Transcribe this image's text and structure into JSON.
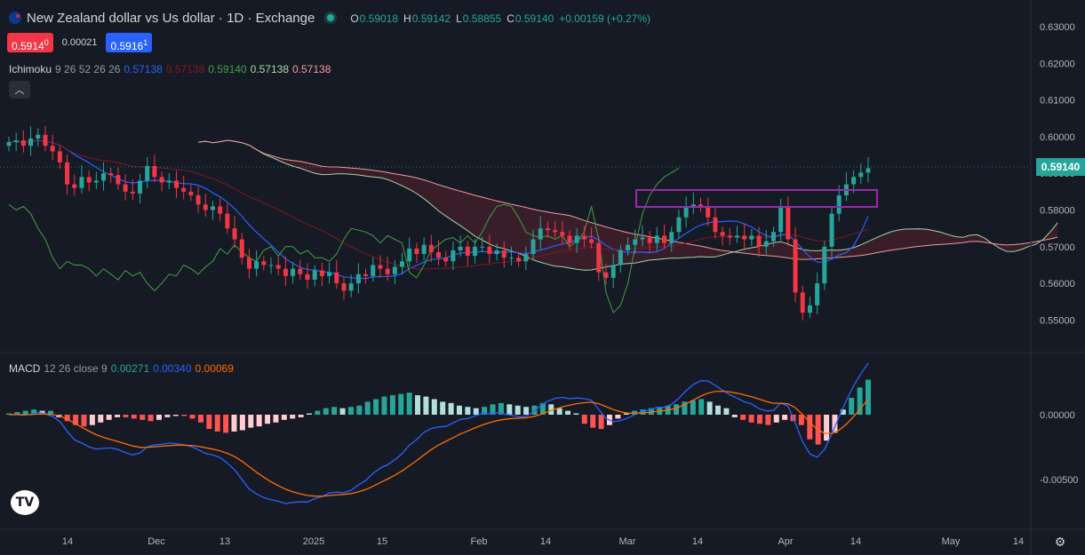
{
  "header": {
    "title": "New Zealand dollar vs Us dollar · 1D · Exchange",
    "ohlc": [
      {
        "k": "O",
        "v": "0.59018"
      },
      {
        "k": "H",
        "v": "0.59142"
      },
      {
        "k": "L",
        "v": "0.58855"
      },
      {
        "k": "C",
        "v": "0.59140"
      },
      {
        "k": "",
        "v": "+0.00159 (+0.27%)"
      }
    ]
  },
  "trade": {
    "sell_main": "0.5914",
    "sell_sup": "0",
    "spread": "0.00021",
    "buy_main": "0.5916",
    "buy_sup": "1"
  },
  "ichimoku": {
    "label": "Ichimoku",
    "params": "9 26 52 26 26",
    "v1": "0.57138",
    "v2": "0.57138",
    "v3": "0.59140",
    "v4": "0.57138",
    "v5": "0.57138"
  },
  "macd": {
    "label": "MACD",
    "params": "12 26 close 9",
    "hist": "0.00271",
    "macd": "0.00340",
    "signal": "0.00069"
  },
  "collapse_icon": "chevron-up-icon",
  "current_price": "0.59140",
  "logo_text": "TV",
  "colors": {
    "bg": "#161a25",
    "up": "#26a69a",
    "down": "#f23645",
    "conversion": "#2962ff",
    "base": "#801922",
    "lagging": "#43a047",
    "span_a": "#a5d6a7",
    "span_b": "#ef9a9a",
    "macd_line": "#2962ff",
    "signal_line": "#ff6d00",
    "box": "#9c27b0"
  },
  "chart_data": {
    "type": "candlestick",
    "price_axis": [
      "0.63000",
      "0.62000",
      "0.61000",
      "0.60000",
      "0.59000",
      "0.58000",
      "0.57000",
      "0.56000",
      "0.55000"
    ],
    "macd_axis": [
      "0.00000",
      "-0.00500"
    ],
    "time_axis": [
      "14",
      "Dec",
      "13",
      "2025",
      "15",
      "Feb",
      "14",
      "Mar",
      "14",
      "Apr",
      "14",
      "May",
      "14"
    ],
    "candles_close": [
      0.5985,
      0.599,
      0.5975,
      0.5995,
      0.6005,
      0.5975,
      0.596,
      0.593,
      0.587,
      0.586,
      0.589,
      0.5875,
      0.588,
      0.59,
      0.5895,
      0.587,
      0.585,
      0.5845,
      0.588,
      0.592,
      0.589,
      0.5875,
      0.588,
      0.586,
      0.585,
      0.584,
      0.5815,
      0.58,
      0.581,
      0.579,
      0.575,
      0.572,
      0.567,
      0.564,
      0.566,
      0.565,
      0.565,
      0.564,
      0.562,
      0.564,
      0.5625,
      0.561,
      0.5635,
      0.562,
      0.563,
      0.56,
      0.558,
      0.56,
      0.5625,
      0.562,
      0.565,
      0.564,
      0.5625,
      0.5645,
      0.566,
      0.5695,
      0.568,
      0.5705,
      0.5685,
      0.567,
      0.566,
      0.569,
      0.57,
      0.5675,
      0.57,
      0.57,
      0.568,
      0.569,
      0.567,
      0.567,
      0.566,
      0.568,
      0.572,
      0.575,
      0.5745,
      0.574,
      0.573,
      0.571,
      0.573,
      0.572,
      0.571,
      0.563,
      0.5615,
      0.565,
      0.569,
      0.5705,
      0.572,
      0.5725,
      0.571,
      0.573,
      0.571,
      0.574,
      0.578,
      0.581,
      0.5815,
      0.581,
      0.578,
      0.574,
      0.573,
      0.5725,
      0.573,
      0.572,
      0.573,
      0.57,
      0.5715,
      0.574,
      0.581,
      0.572,
      0.5575,
      0.552,
      0.554,
      0.56,
      0.57,
      0.579,
      0.584,
      0.587,
      0.589,
      0.5902,
      0.5914
    ],
    "macd_hist": [
      0.0001,
      0.0002,
      0.0003,
      0.0004,
      0.0003,
      0.0003,
      -0.0002,
      -0.0005,
      -0.0008,
      -0.0009,
      -0.0008,
      -0.0006,
      -0.0004,
      -0.0002,
      -0.0002,
      -0.0003,
      -0.0004,
      -0.0005,
      -0.0004,
      -0.0002,
      -0.0001,
      -0.0001,
      -0.0003,
      -0.0006,
      -0.0011,
      -0.0013,
      -0.0014,
      -0.0013,
      -0.0012,
      -0.001,
      -0.0009,
      -0.0007,
      -0.0006,
      -0.0004,
      -0.0003,
      -0.0002,
      0.0001,
      0.0003,
      0.0005,
      0.0006,
      0.0005,
      0.0006,
      0.0007,
      0.001,
      0.0012,
      0.0014,
      0.0015,
      0.0016,
      0.0017,
      0.0015,
      0.0014,
      0.0012,
      0.001,
      0.0009,
      0.0007,
      0.0006,
      0.0005,
      0.0006,
      0.0008,
      0.0009,
      0.0008,
      0.0007,
      0.0006,
      0.0007,
      0.0009,
      0.0008,
      0.0005,
      0.0003,
      0.0001,
      -0.0007,
      -0.001,
      -0.0011,
      -0.0008,
      -0.0003,
      0.0001,
      0.0003,
      0.0004,
      0.0005,
      0.0006,
      0.0007,
      0.0008,
      0.001,
      0.0011,
      0.0012,
      0.001,
      0.0007,
      0.0005,
      -0.0002,
      -0.0004,
      -0.0006,
      -0.0007,
      -0.0008,
      -0.0006,
      -0.0004,
      -0.0005,
      -0.0008,
      -0.0019,
      -0.0023,
      -0.002,
      -0.0014,
      0.0004,
      0.0013,
      0.0021,
      0.0027
    ]
  }
}
